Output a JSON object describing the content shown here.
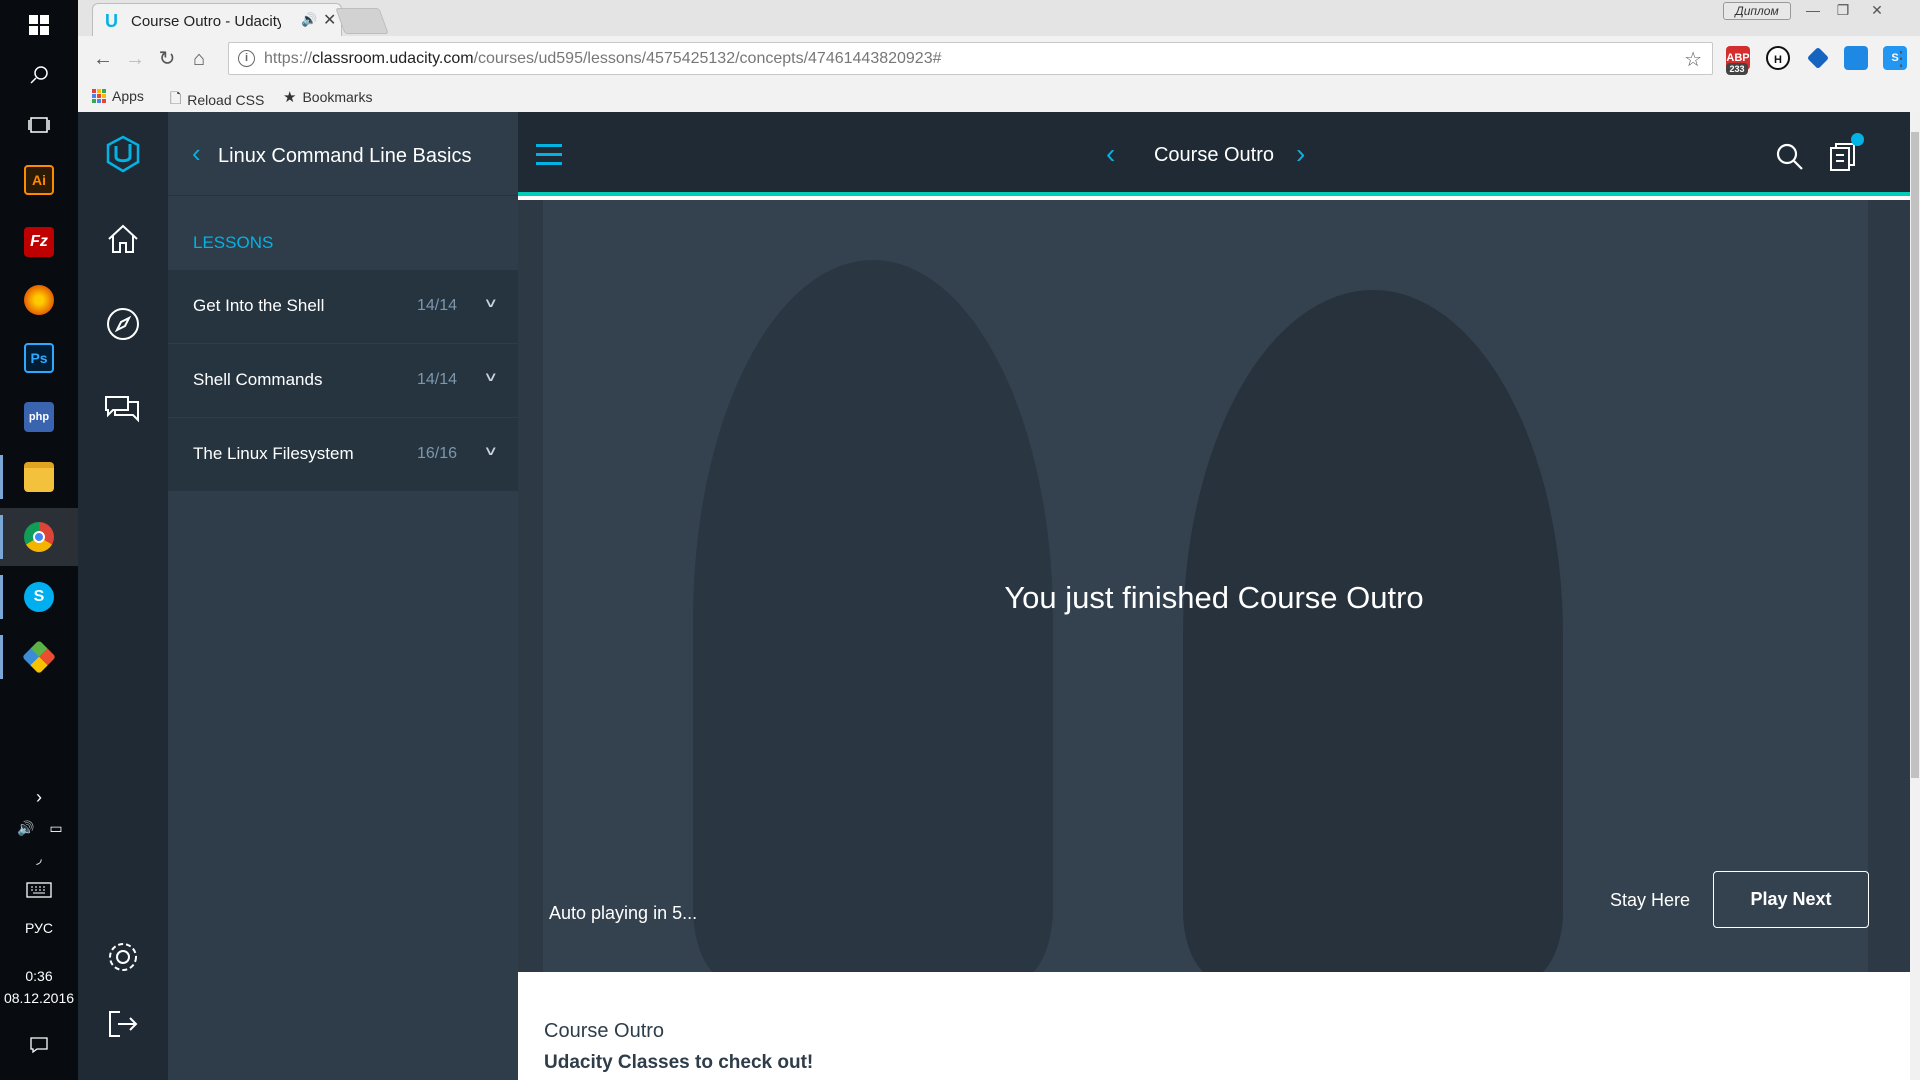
{
  "taskbar": {
    "language": "РУС",
    "time": "0:36",
    "date": "08.12.2016",
    "apps": [
      "windows-start",
      "search",
      "task-view",
      "illustrator",
      "filezilla",
      "firefox",
      "photoshop",
      "php",
      "file-explorer",
      "chrome",
      "skype",
      "git"
    ]
  },
  "browser": {
    "tab": {
      "title": "Course Outro - Udacity"
    },
    "user_badge": "Диплом",
    "url_prefix": "https://",
    "url_domain": "classroom.udacity.com",
    "url_path": "/courses/ud595/lessons/4575425132/concepts/47461443820923#",
    "extensions": [
      {
        "name": "adblock",
        "badge": "233",
        "color": "#d32f2f"
      },
      {
        "name": "hola",
        "color": "#222222"
      },
      {
        "name": "ext-blue",
        "color": "#1565c0"
      },
      {
        "name": "ext-window",
        "color": "#1e88e5"
      },
      {
        "name": "ext-s",
        "color": "#2196f3"
      },
      {
        "name": "color-picker",
        "color": "#e53935"
      }
    ],
    "bookmarks": {
      "apps": "Apps",
      "reload_css": "Reload CSS",
      "bookmarks": "Bookmarks"
    }
  },
  "sidebar": {
    "course_title": "Linux Command Line Basics",
    "lessons_label": "LESSONS",
    "lessons": [
      {
        "name": "Get Into the Shell",
        "progress": "14/14"
      },
      {
        "name": "Shell Commands",
        "progress": "14/14"
      },
      {
        "name": "The Linux Filesystem",
        "progress": "16/16"
      }
    ]
  },
  "header": {
    "concept_title": "Course Outro"
  },
  "video": {
    "finished_message": "You just finished Course Outro",
    "autoplay_text": "Auto playing in  5...",
    "stay_here": "Stay Here",
    "play_next": "Play Next"
  },
  "content": {
    "title": "Course Outro",
    "subtitle": "Udacity Classes to check out!"
  },
  "colors": {
    "accent": "#02b3e4",
    "teal": "#02ccba",
    "dark": "#1f2a34",
    "panel": "#2e3d49"
  }
}
